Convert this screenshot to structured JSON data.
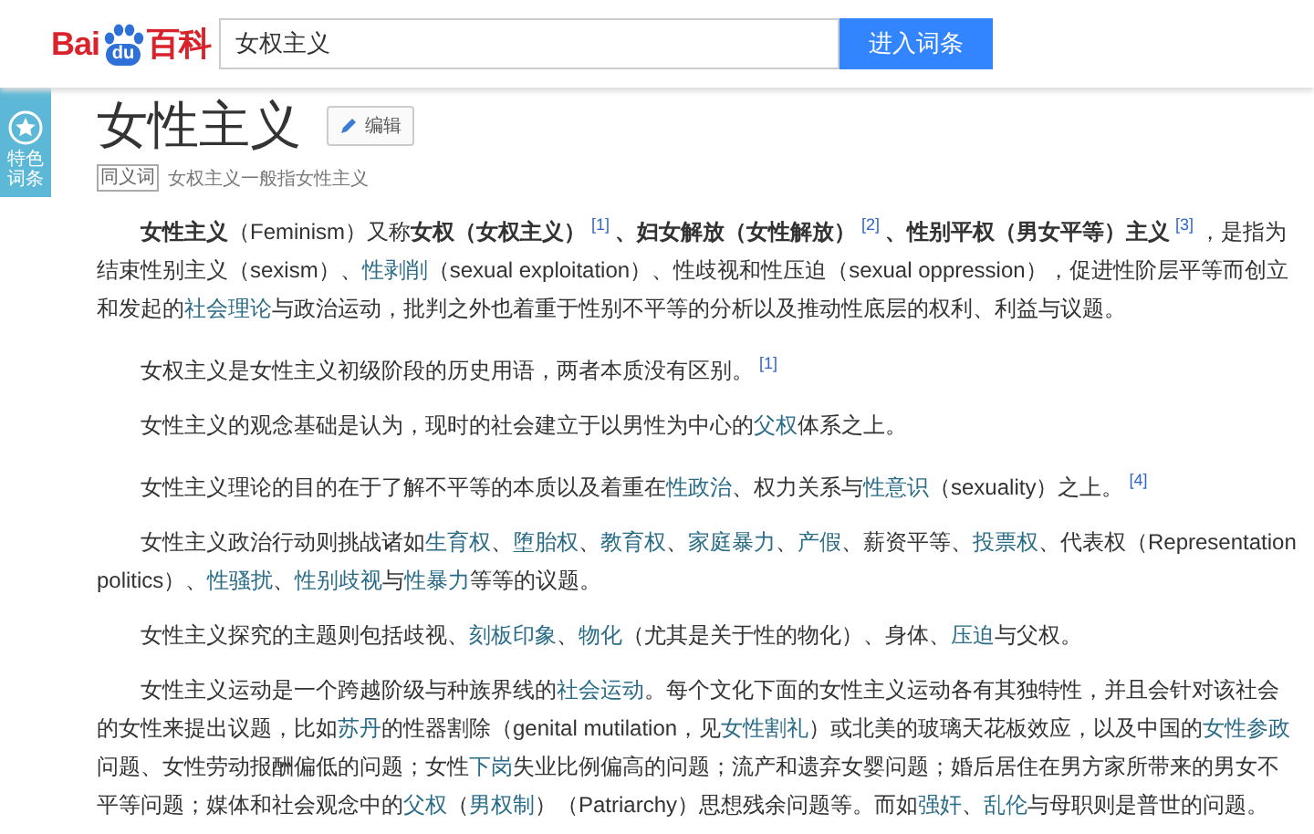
{
  "header": {
    "logo": {
      "left": "Bai",
      "paw": "du",
      "right": "百科"
    },
    "search": {
      "value": "女权主义"
    },
    "button": "进入词条"
  },
  "badge": {
    "label": "特色词条"
  },
  "title": "女性主义",
  "edit_button": "编辑",
  "synonym": {
    "tag": "同义词",
    "text": "女权主义一般指女性主义"
  },
  "paragraphs": [
    [
      {
        "kind": "bold",
        "text": "女性主义"
      },
      {
        "kind": "text",
        "text": "（Feminism）又称"
      },
      {
        "kind": "bold",
        "text": "女权（女权主义）"
      },
      {
        "kind": "ref",
        "text": "[1]"
      },
      {
        "kind": "bold",
        "text": "、妇女解放（女性解放）"
      },
      {
        "kind": "ref",
        "text": "[2]"
      },
      {
        "kind": "bold",
        "text": "、性别平权（男女平等）主义"
      },
      {
        "kind": "ref",
        "text": "[3]"
      },
      {
        "kind": "text",
        "text": "，是指为结束性别主义（sexism）、"
      },
      {
        "kind": "link",
        "text": "性剥削"
      },
      {
        "kind": "text",
        "text": "（sexual exploitation）、性歧视和性压迫（sexual oppression），促进性阶层平等而创立和发起的"
      },
      {
        "kind": "link",
        "text": "社会理论"
      },
      {
        "kind": "text",
        "text": "与政治运动，批判之外也着重于性别不平等的分析以及推动性底层的权利、利益与议题。"
      }
    ],
    [
      {
        "kind": "text",
        "text": "女权主义是女性主义初级阶段的历史用语，两者本质没有区别。"
      },
      {
        "kind": "ref",
        "text": "[1]"
      }
    ],
    [
      {
        "kind": "text",
        "text": "女性主义的观念基础是认为，现时的社会建立于以男性为中心的"
      },
      {
        "kind": "link",
        "text": "父权"
      },
      {
        "kind": "text",
        "text": "体系之上。"
      }
    ],
    [
      {
        "kind": "text",
        "text": "女性主义理论的目的在于了解不平等的本质以及着重在"
      },
      {
        "kind": "link",
        "text": "性政治"
      },
      {
        "kind": "text",
        "text": "、权力关系与"
      },
      {
        "kind": "link",
        "text": "性意识"
      },
      {
        "kind": "text",
        "text": "（sexuality）之上。"
      },
      {
        "kind": "ref",
        "text": "[4]"
      }
    ],
    [
      {
        "kind": "text",
        "text": "女性主义政治行动则挑战诸如"
      },
      {
        "kind": "link",
        "text": "生育权"
      },
      {
        "kind": "text",
        "text": "、"
      },
      {
        "kind": "link",
        "text": "堕胎权"
      },
      {
        "kind": "text",
        "text": "、"
      },
      {
        "kind": "link",
        "text": "教育权"
      },
      {
        "kind": "text",
        "text": "、"
      },
      {
        "kind": "link",
        "text": "家庭暴力"
      },
      {
        "kind": "text",
        "text": "、"
      },
      {
        "kind": "link",
        "text": "产假"
      },
      {
        "kind": "text",
        "text": "、薪资平等、"
      },
      {
        "kind": "link",
        "text": "投票权"
      },
      {
        "kind": "text",
        "text": "、代表权（Representation politics）、"
      },
      {
        "kind": "link",
        "text": "性骚扰"
      },
      {
        "kind": "text",
        "text": "、"
      },
      {
        "kind": "link",
        "text": "性别歧视"
      },
      {
        "kind": "text",
        "text": "与"
      },
      {
        "kind": "link",
        "text": "性暴力"
      },
      {
        "kind": "text",
        "text": "等等的议题。"
      }
    ],
    [
      {
        "kind": "text",
        "text": "女性主义探究的主题则包括歧视、"
      },
      {
        "kind": "link",
        "text": "刻板印象"
      },
      {
        "kind": "text",
        "text": "、"
      },
      {
        "kind": "link",
        "text": "物化"
      },
      {
        "kind": "text",
        "text": "（尤其是关于性的物化）、身体、"
      },
      {
        "kind": "link",
        "text": "压迫"
      },
      {
        "kind": "text",
        "text": "与父权。"
      }
    ],
    [
      {
        "kind": "text",
        "text": "女性主义运动是一个跨越阶级与种族界线的"
      },
      {
        "kind": "link",
        "text": "社会运动"
      },
      {
        "kind": "text",
        "text": "。每个文化下面的女性主义运动各有其独特性，并且会针对该社会的女性来提出议题，比如"
      },
      {
        "kind": "link",
        "text": "苏丹"
      },
      {
        "kind": "text",
        "text": "的性器割除（genital mutilation，见"
      },
      {
        "kind": "link",
        "text": "女性割礼"
      },
      {
        "kind": "text",
        "text": "）或北美的玻璃天花板效应，以及中国的"
      },
      {
        "kind": "link",
        "text": "女性参政"
      },
      {
        "kind": "text",
        "text": "问题、女性劳动报酬偏低的问题；女性"
      },
      {
        "kind": "link",
        "text": "下岗"
      },
      {
        "kind": "text",
        "text": "失业比例偏高的问题；流产和遗弃女婴问题；婚后居住在男方家所带来的男女不平等问题；媒体和社会观念中的"
      },
      {
        "kind": "link",
        "text": "父权"
      },
      {
        "kind": "text",
        "text": "（"
      },
      {
        "kind": "link",
        "text": "男权制"
      },
      {
        "kind": "text",
        "text": "）（Patriarchy）思想残余问题等。而如"
      },
      {
        "kind": "link",
        "text": "强奸"
      },
      {
        "kind": "text",
        "text": "、"
      },
      {
        "kind": "link",
        "text": "乱伦"
      },
      {
        "kind": "text",
        "text": "与母职则是普世的问题。"
      }
    ]
  ]
}
